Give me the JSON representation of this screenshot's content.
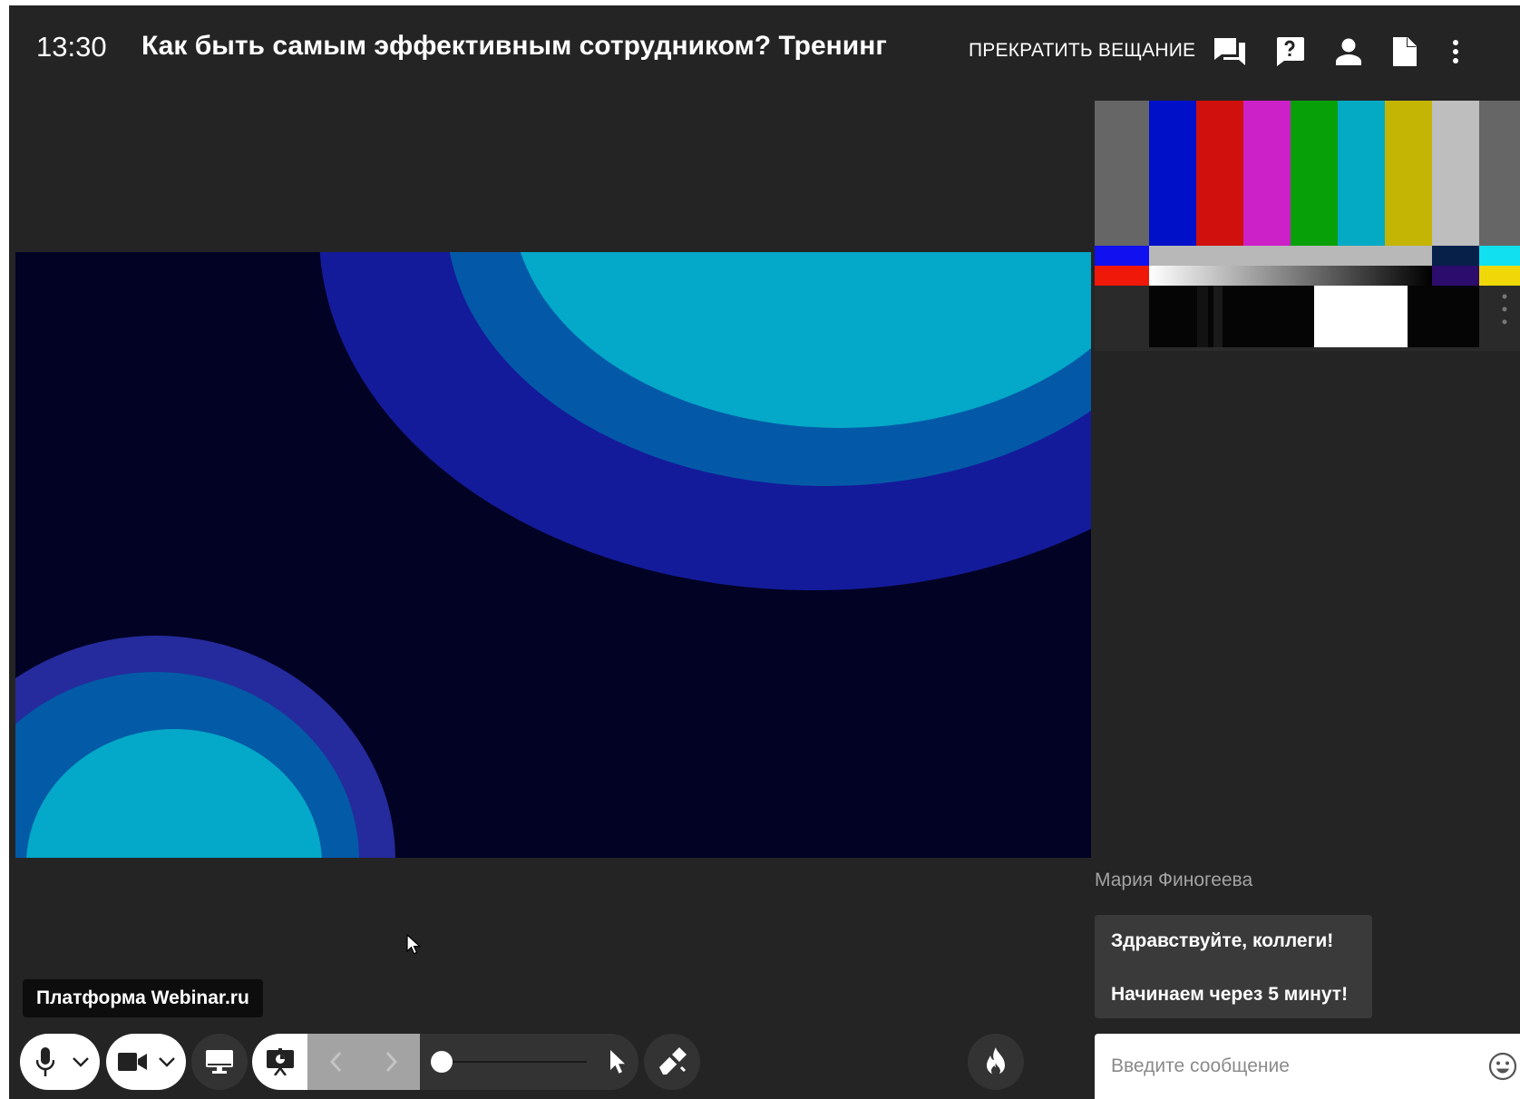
{
  "header": {
    "time": "13:30",
    "title": "Как быть самым эффективным сотрудником? Тренинг",
    "stop_broadcast_label": "ПРЕКРАТИТЬ ВЕЩАНИЕ",
    "icons": [
      "chat-icon",
      "question-icon",
      "person-icon",
      "document-icon",
      "more-vertical-icon"
    ]
  },
  "slide": {
    "colors": {
      "background": "#020224",
      "outer_ring": "#141b9a",
      "middle_ring": "#0359a8",
      "inner_disk": "#04a8c8"
    }
  },
  "video": {
    "test_pattern_colors": [
      "#666666",
      "#0010c8",
      "#d0100c",
      "#cc20c8",
      "#08a008",
      "#04aac4",
      "#c4b404",
      "#bebebe"
    ]
  },
  "chat": {
    "author": "Мария Финогеева",
    "messages": [
      "Здравствуйте, коллеги!",
      "Начинаем через 5 минут!"
    ],
    "input_placeholder": "Введите сообщение",
    "emoji_icon": "emoji-icon"
  },
  "toolbar": {
    "brand_label": "Платформа Webinar.ru",
    "zoom_level": 0,
    "icons": [
      "microphone-icon",
      "chevron-down-icon",
      "camera-icon",
      "chevron-down-icon",
      "screen-share-icon",
      "presentation-icon",
      "arrow-left-icon",
      "arrow-right-icon",
      "pointer-icon",
      "eraser-icon",
      "fire-icon"
    ]
  },
  "colors": {
    "app_background": "#242424",
    "toolbar_dark": "#333333"
  }
}
